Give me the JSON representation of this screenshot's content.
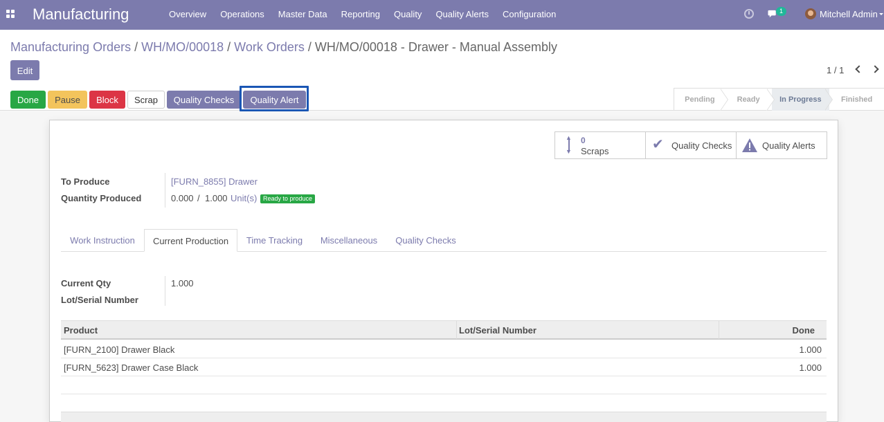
{
  "navbar": {
    "brand": "Manufacturing",
    "menu": [
      "Overview",
      "Operations",
      "Master Data",
      "Reporting",
      "Quality",
      "Quality Alerts",
      "Configuration"
    ],
    "chat_count": "1",
    "user": "Mitchell Admin"
  },
  "breadcrumb": {
    "items": [
      "Manufacturing Orders",
      "WH/MO/00018",
      "Work Orders"
    ],
    "separator": "/",
    "current": "WH/MO/00018 - Drawer - Manual Assembly"
  },
  "actions": {
    "edit": "Edit",
    "done": "Done",
    "pause": "Pause",
    "block": "Block",
    "scrap": "Scrap",
    "quality_checks": "Quality Checks",
    "quality_alert": "Quality Alert"
  },
  "pager": {
    "value": "1 / 1"
  },
  "status": {
    "steps": [
      "Pending",
      "Ready",
      "In Progress",
      "Finished"
    ],
    "current": "In Progress"
  },
  "smart_buttons": {
    "scraps_count": "0",
    "scraps_label": "Scraps",
    "quality_checks": "Quality Checks",
    "quality_alerts": "Quality Alerts"
  },
  "form": {
    "to_produce_label": "To Produce",
    "to_produce_value": "[FURN_8855] Drawer",
    "qty_produced_label": "Quantity Produced",
    "qty_done": "0.000",
    "qty_sep": "/",
    "qty_total": "1.000",
    "uom": "Unit(s)",
    "state_badge": "Ready to produce"
  },
  "tabs": [
    "Work Instruction",
    "Current Production",
    "Time Tracking",
    "Miscellaneous",
    "Quality Checks"
  ],
  "active_tab": "Current Production",
  "current_production": {
    "current_qty_label": "Current Qty",
    "current_qty_value": "1.000",
    "lot_label": "Lot/Serial Number",
    "lot_value": ""
  },
  "table": {
    "columns": [
      "Product",
      "Lot/Serial Number",
      "Done"
    ],
    "rows": [
      {
        "product": "[FURN_2100] Drawer Black",
        "lot": "",
        "done": "1.000"
      },
      {
        "product": "[FURN_5623] Drawer Case Black",
        "lot": "",
        "done": "1.000"
      }
    ]
  },
  "colors": {
    "brand": "#7c7bad",
    "done": "#28a745",
    "pause": "#f3c45c",
    "block": "#dc3545",
    "highlight_frame": "#1a56b4"
  },
  "icons": {
    "apps": "apps-grid-icon",
    "clock": "clock-icon",
    "chat": "chat-icon",
    "scraps": "arrows-vertical-icon",
    "quality_checks": "check-icon",
    "quality_alerts": "warning-icon",
    "pager_prev": "chevron-left-icon",
    "pager_next": "chevron-right-icon"
  }
}
